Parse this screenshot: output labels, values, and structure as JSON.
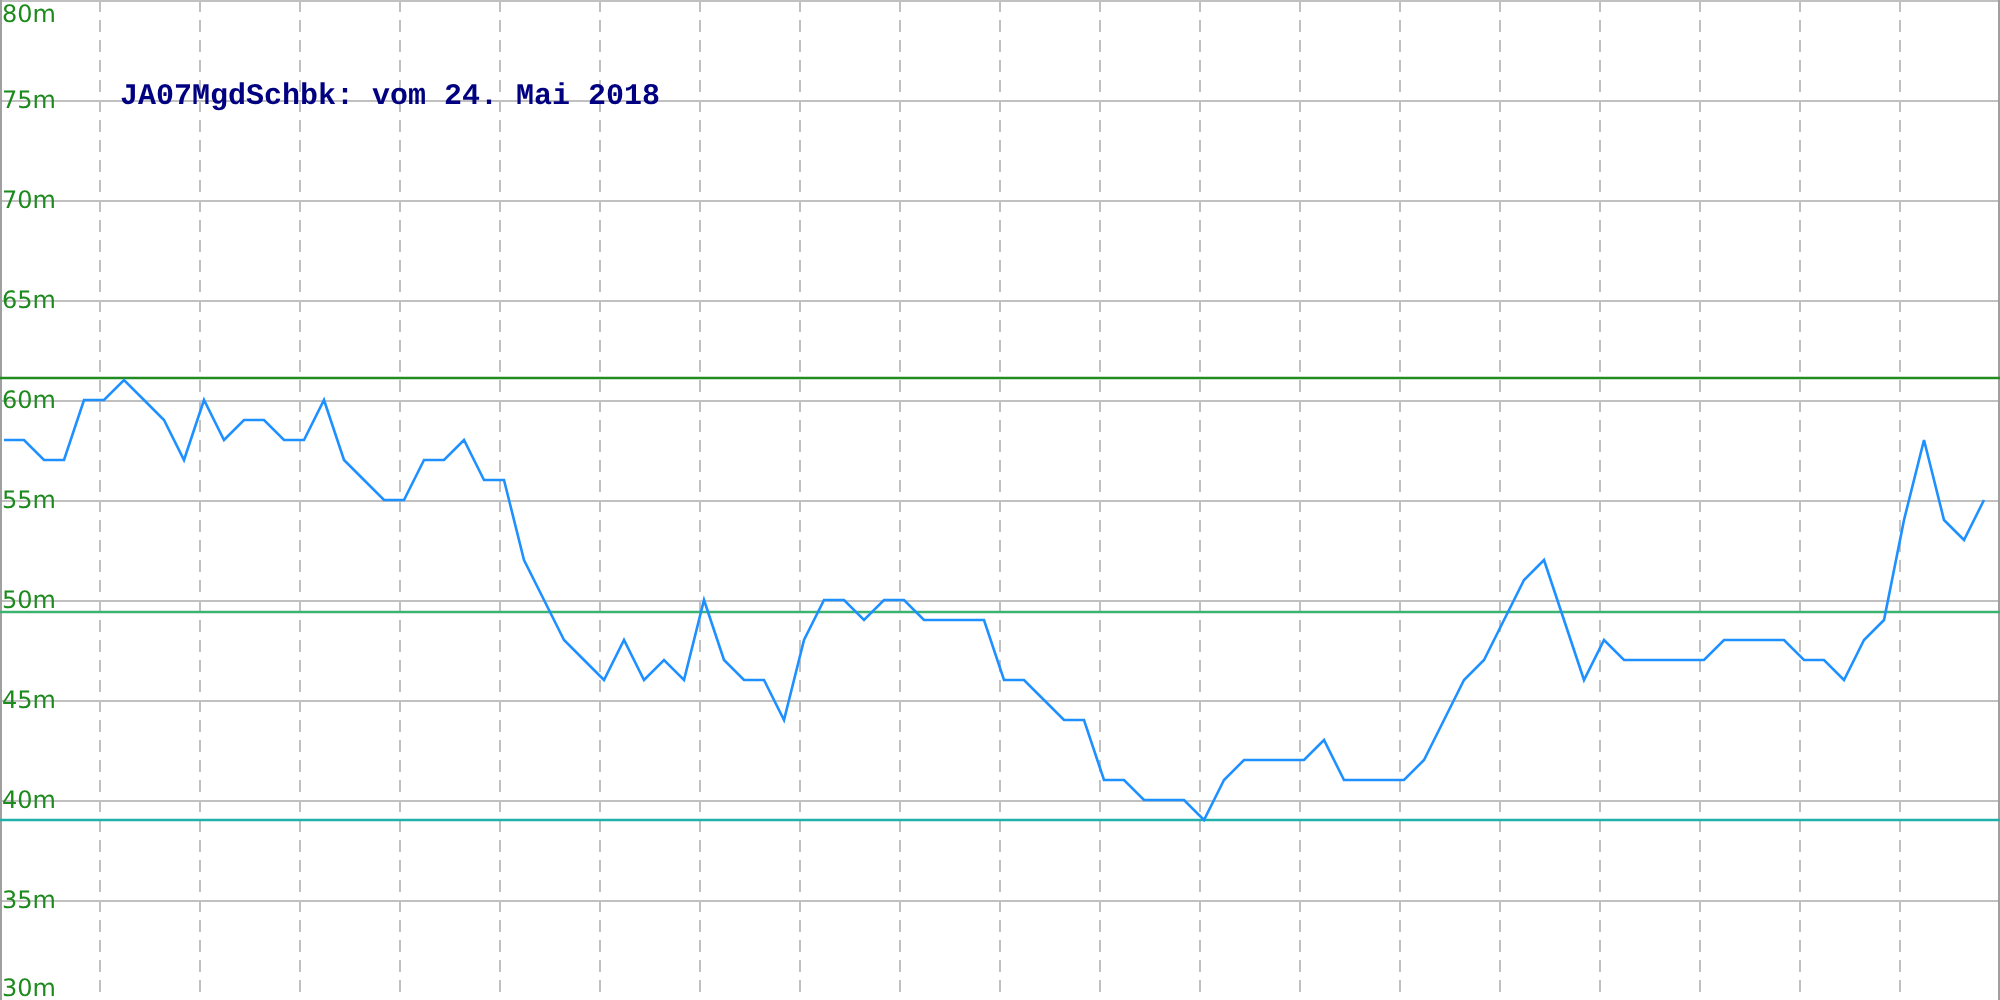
{
  "chart_data": {
    "type": "line",
    "title": "JA07MgdSchbk: vom 24. Mai 2018",
    "ylim": [
      30,
      80
    ],
    "yticks": [
      {
        "value": 80,
        "label": "80m"
      },
      {
        "value": 75,
        "label": "75m"
      },
      {
        "value": 70,
        "label": "70m"
      },
      {
        "value": 65,
        "label": "65m"
      },
      {
        "value": 60,
        "label": "60m"
      },
      {
        "value": 55,
        "label": "55m"
      },
      {
        "value": 50,
        "label": "50m"
      },
      {
        "value": 45,
        "label": "45m"
      },
      {
        "value": 40,
        "label": "40m"
      },
      {
        "value": 35,
        "label": "35m"
      },
      {
        "value": 30,
        "label": "30m"
      }
    ],
    "series": [
      {
        "color": "#1e90ff",
        "values": [
          58,
          58,
          57,
          57,
          60,
          60,
          61,
          60,
          59,
          57,
          60,
          58,
          59,
          59,
          58,
          58,
          60,
          57,
          56,
          55,
          55,
          57,
          57,
          58,
          56,
          56,
          52,
          50,
          48,
          47,
          46,
          48,
          46,
          47,
          46,
          50,
          47,
          46,
          46,
          44,
          48,
          50,
          50,
          49,
          50,
          50,
          49,
          49,
          49,
          49,
          46,
          46,
          45,
          44,
          44,
          41,
          41,
          40,
          40,
          40,
          39,
          41,
          42,
          42,
          42,
          42,
          43,
          41,
          41,
          41,
          41,
          42,
          44,
          46,
          47,
          49,
          51,
          52,
          49,
          46,
          48,
          47,
          47,
          47,
          47,
          47,
          48,
          48,
          48,
          48,
          47,
          47,
          46,
          48,
          49,
          54,
          58,
          54,
          53,
          55
        ]
      }
    ],
    "grid": true,
    "ref_lines": [
      {
        "axis": "y",
        "value": 61.1,
        "color": "#228b22"
      },
      {
        "axis": "y",
        "value": 49.4,
        "color": "#3cb371"
      },
      {
        "axis": "y",
        "value": 39,
        "color": "#20b2aa"
      }
    ]
  }
}
